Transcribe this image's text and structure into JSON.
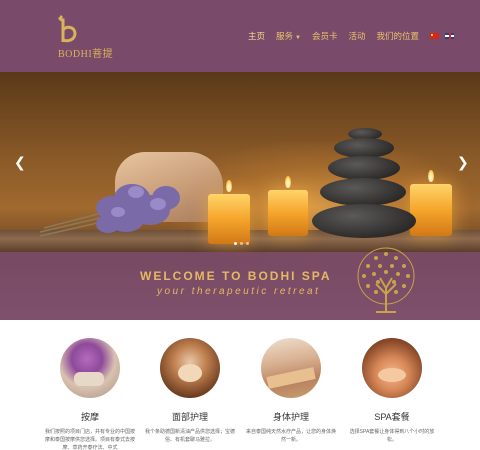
{
  "brand": {
    "name": "BODHI",
    "name_cn": "菩提",
    "color": "#d9b35a"
  },
  "header": {
    "background": "#7a4a6b"
  },
  "nav": {
    "items": [
      {
        "label": "主页",
        "active": true
      },
      {
        "label": "服务",
        "has_dropdown": true
      },
      {
        "label": "会员卡"
      },
      {
        "label": "活动"
      },
      {
        "label": "我们的位置"
      }
    ],
    "languages": [
      "zh-CN",
      "en"
    ]
  },
  "hero": {
    "title": "WELCOME TO BODHI SPA",
    "subtitle": "your therapeutic retreat",
    "prev_icon": "chevron-left-icon",
    "next_icon": "chevron-right-icon",
    "slides": 3,
    "active_slide": 1
  },
  "services": [
    {
      "title": "按摩",
      "desc": "我们按照的项目门店，并有专业的中国按摩和泰国按摩供您选择。项目有泰式去按摩、草药开泰疗法、中式"
    },
    {
      "title": "面部护理",
      "desc": "我个条助德国新清油产品供您选择；宝德俗、有机套聊马雅拉。"
    },
    {
      "title": "身体护理",
      "desc": "来自泰国纯天然水疗产品，让您的身体焕然一新。"
    },
    {
      "title": "SPA套餐",
      "desc": "选择SPA套餐让身体得到八个小时的放松。"
    }
  ]
}
